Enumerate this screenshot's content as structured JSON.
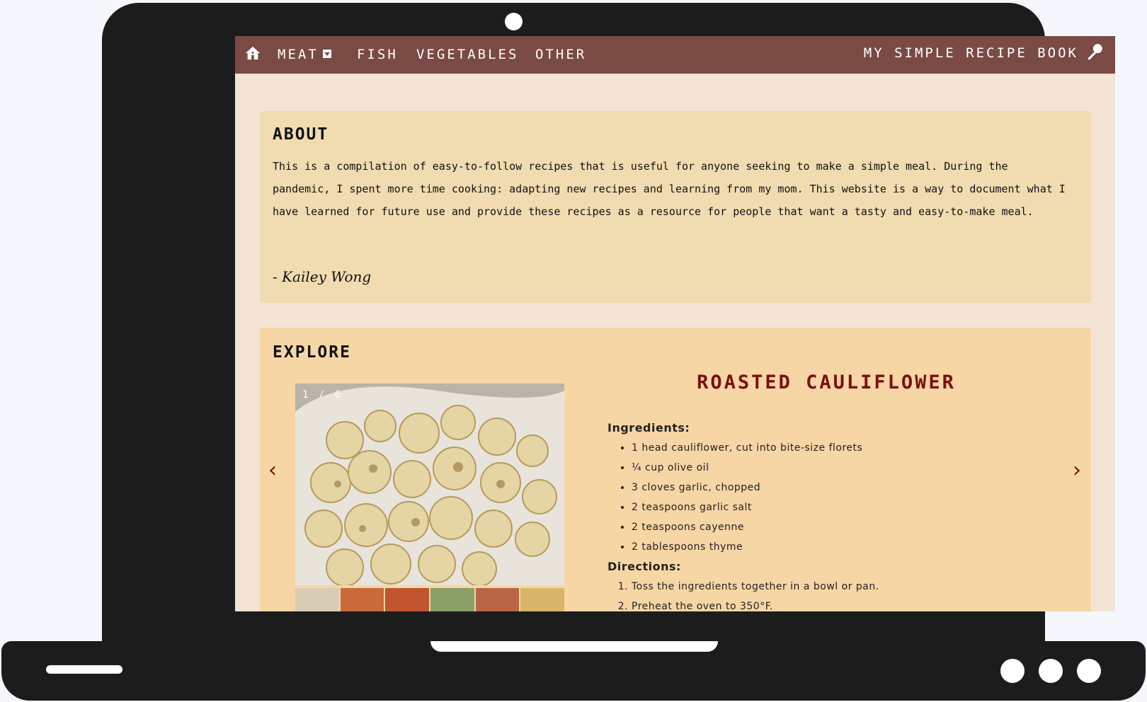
{
  "nav": {
    "items": [
      {
        "label": "MEAT",
        "has_dropdown": true
      },
      {
        "label": "FISH"
      },
      {
        "label": "VEGETABLES"
      },
      {
        "label": "OTHER"
      }
    ],
    "brand": "MY SIMPLE RECIPE BOOK",
    "home_icon": "home-icon",
    "brand_icon": "pin-icon"
  },
  "about": {
    "title": "ABOUT",
    "text": "This is a compilation of easy-to-follow recipes that is useful for anyone seeking to make a simple meal. During the pandemic, I spent more time cooking: adapting new recipes and learning from my mom. This website is a way to document what I have learned for future use and provide these recipes as a resource for people that want a tasty and easy-to-make meal.",
    "signature": "- Kailey Wong"
  },
  "explore": {
    "title": "EXPLORE",
    "counter": "1 / 6",
    "prev_arrow": "‹",
    "next_arrow": "›",
    "recipe": {
      "title": "ROASTED CAULIFLOWER",
      "ingredients_heading": "Ingredients:",
      "ingredients": [
        "1 head cauliflower, cut into bite-size florets",
        "¼ cup olive oil",
        "3 cloves garlic, chopped",
        "2 teaspoons garlic salt",
        "2 teaspoons cayenne",
        "2 tablespoons thyme"
      ],
      "directions_heading": "Directions:",
      "directions": [
        "Toss the ingredients together in a bowl or pan.",
        "Preheat the oven to 350°F."
      ]
    },
    "thumbnail_colors": [
      "#d8cdb4",
      "#c86a3c",
      "#c0552f",
      "#8aa067",
      "#b86646",
      "#d9b56a"
    ]
  },
  "colors": {
    "nav_bg": "#7a4a45",
    "page_bg": "#f4e4d5",
    "about_bg": "#f0dcb0",
    "explore_bg": "#f6d6a5",
    "accent": "#7a0f0f"
  }
}
